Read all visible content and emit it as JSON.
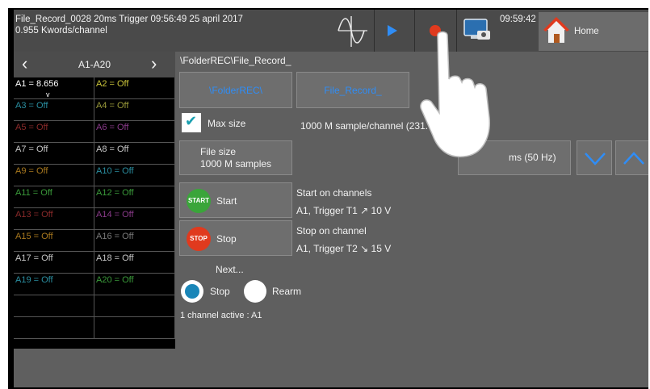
{
  "header": {
    "record_line1": "File_Record_0028  20ms  Trigger 09:56:49 25 april 2017",
    "record_line2": "0.955 Kwords/channel",
    "clock": "09:59:42",
    "home_label": "Home",
    "icons": [
      "sine-wave-icon",
      "play-icon",
      "record-icon",
      "screen-capture-icon",
      "home-icon"
    ]
  },
  "channels": {
    "range": "A1-A20",
    "cells": [
      {
        "label": "A1 = 8.656",
        "color": "#ffffff",
        "unit": "v"
      },
      {
        "label": "A2 = Off",
        "color": "#c9c33a"
      },
      {
        "label": "A3 = Off",
        "color": "#2a8ea0"
      },
      {
        "label": "A4 = Off",
        "color": "#9a9a3a"
      },
      {
        "label": "A5 = Off",
        "color": "#8a2a2a"
      },
      {
        "label": "A6 = Off",
        "color": "#8a3a8a"
      },
      {
        "label": "A7 = Off",
        "color": "#c8c8c8"
      },
      {
        "label": "A8 = Off",
        "color": "#c8c8c8"
      },
      {
        "label": "A9 = Off",
        "color": "#a8781e"
      },
      {
        "label": "A10 = Off",
        "color": "#2a8ea0"
      },
      {
        "label": "A11 = Off",
        "color": "#3a9a3a"
      },
      {
        "label": "A12 = Off",
        "color": "#3a9a3a"
      },
      {
        "label": "A13 = Off",
        "color": "#8a2a2a"
      },
      {
        "label": "A14 = Off",
        "color": "#8a3a8a"
      },
      {
        "label": "A15 = Off",
        "color": "#a8781e"
      },
      {
        "label": "A16 = Off",
        "color": "#7a7a7a"
      },
      {
        "label": "A17 = Off",
        "color": "#c8c8c8"
      },
      {
        "label": "A18 = Off",
        "color": "#c8c8c8"
      },
      {
        "label": "A19 = Off",
        "color": "#2a8ea0"
      },
      {
        "label": "A20 = Off",
        "color": "#3a9a3a"
      }
    ]
  },
  "main": {
    "path": "\\FolderREC\\File_Record_",
    "folder_button": "\\FolderREC\\",
    "file_button": "File_Record_",
    "max_size_label": "Max size",
    "max_size_value": "1000 M sample/channel  (231.",
    "file_size_line1": "File size",
    "file_size_line2": "1000 M samples",
    "period_value": "ms (50 Hz)",
    "start_badge": "START",
    "start_label": "Start",
    "start_condition_title": "Start on channels",
    "start_condition": "A1, Trigger T1 ↗ 10 V",
    "stop_badge": "STOP",
    "stop_label": "Stop",
    "stop_condition_title": "Stop on channel",
    "stop_condition": "A1, Trigger T2 ↘ 15 V",
    "next_label": "Next...",
    "radio_stop": "Stop",
    "radio_rearm": "Rearm",
    "active_info": "1 channel active : A1"
  },
  "colors": {
    "accent_blue": "#2f8df6",
    "check_teal": "#1aa0b0",
    "start_green": "#3aa53a",
    "stop_red": "#e03a1e"
  }
}
